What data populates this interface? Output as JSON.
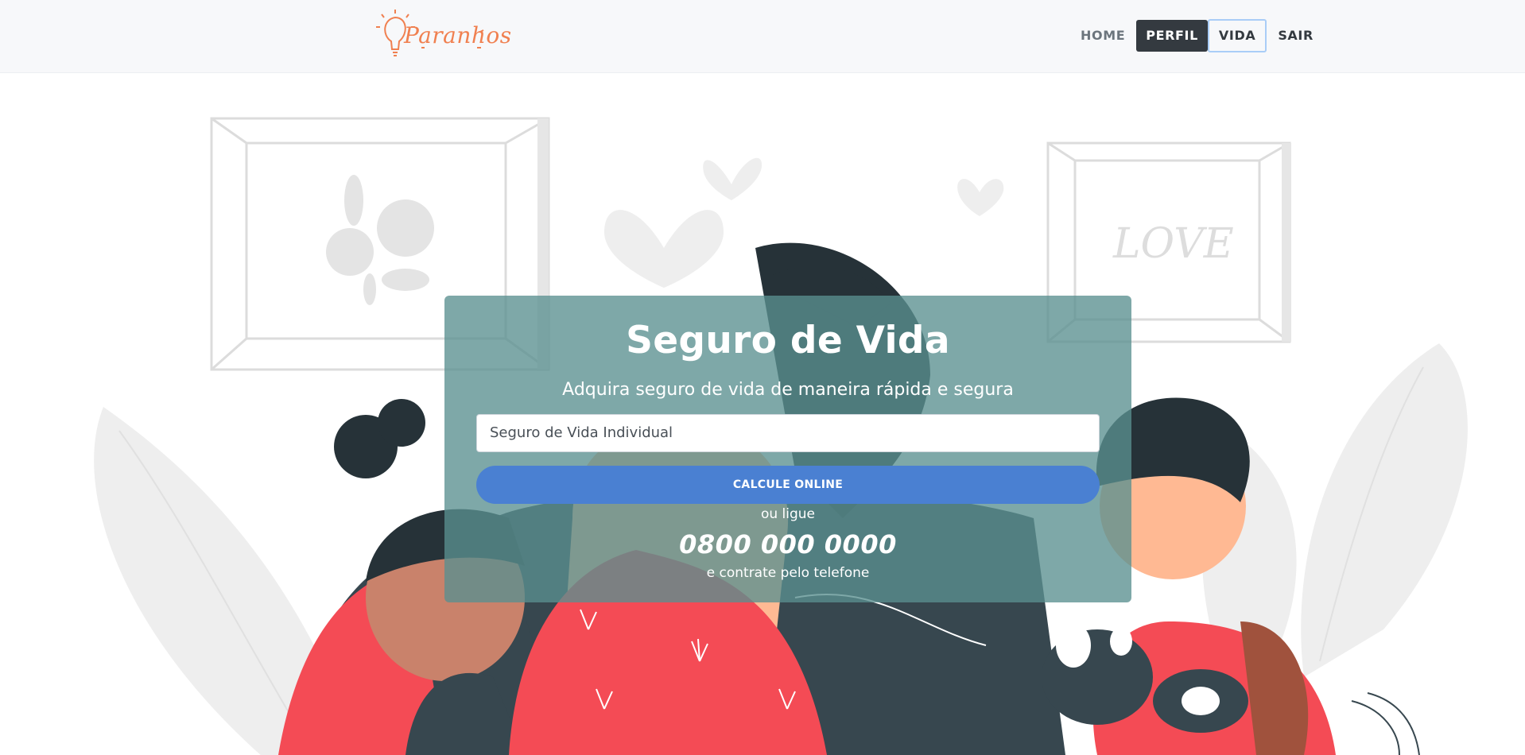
{
  "header": {
    "logo_text": "Paranhos",
    "nav": [
      {
        "label": "HOME"
      },
      {
        "label": "PERFIL"
      },
      {
        "label": "VIDA"
      },
      {
        "label": "SAIR"
      }
    ]
  },
  "hero": {
    "title": "Seguro de Vida",
    "subtitle": "Adquira seguro de vida de maneira rápida e segura",
    "select_value": "Seguro de Vida Individual",
    "cta_label": "CALCULE ONLINE",
    "or_call": "ou ligue",
    "phone": "0800 000 0000",
    "contract_text": "e contrate pelo telefone",
    "frame_text": "LOVE"
  },
  "colors": {
    "brand": "#f08050",
    "card_bg": "#5a9090",
    "cta": "#4a80d2",
    "nav_active": "#343a40",
    "illustration_red": "#f44b55",
    "illustration_dark": "#37474f"
  }
}
